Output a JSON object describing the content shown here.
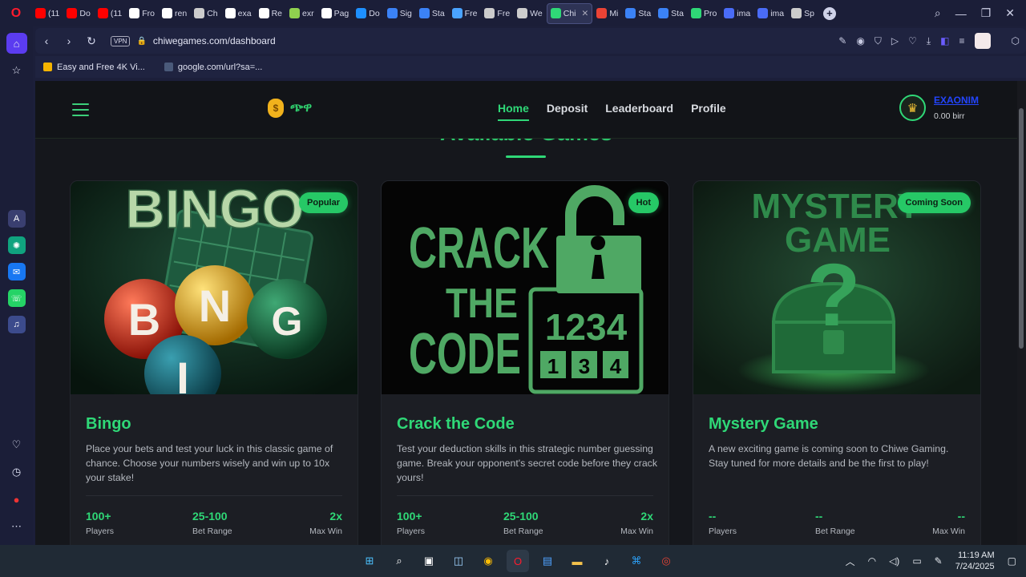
{
  "browser": {
    "tabs": [
      {
        "label": "(11",
        "color": "#ff0000"
      },
      {
        "label": "Do",
        "color": "#ff0000"
      },
      {
        "label": "(11",
        "color": "#ff0000"
      },
      {
        "label": "Fro",
        "color": "#ffffff"
      },
      {
        "label": "ren",
        "color": "#ffffff"
      },
      {
        "label": "Ch",
        "color": "#cccccc"
      },
      {
        "label": "exa",
        "color": "#ffffff"
      },
      {
        "label": "Re",
        "color": "#ffffff"
      },
      {
        "label": "exr",
        "color": "#8fd14f"
      },
      {
        "label": "Pag",
        "color": "#ffffff"
      },
      {
        "label": "Do",
        "color": "#1e90ff"
      },
      {
        "label": "Sig",
        "color": "#3b82f6"
      },
      {
        "label": "Sta",
        "color": "#3b82f6"
      },
      {
        "label": "Fre",
        "color": "#4aa3ff"
      },
      {
        "label": "Fre",
        "color": "#cccccc"
      },
      {
        "label": "We",
        "color": "#cccccc"
      },
      {
        "label": "Chi",
        "color": "#2fd877",
        "active": true
      },
      {
        "label": "Mi",
        "color": "#ea4335"
      },
      {
        "label": "Sta",
        "color": "#3b82f6"
      },
      {
        "label": "Sta",
        "color": "#3b82f6"
      },
      {
        "label": "Pro",
        "color": "#2fd877"
      },
      {
        "label": "ima",
        "color": "#4a6cf7"
      },
      {
        "label": "ima",
        "color": "#4a6cf7"
      },
      {
        "label": "Sp",
        "color": "#cccccc"
      }
    ],
    "url": "chiwegames.com/dashboard",
    "vpn_label": "VPN",
    "bookmarks": [
      {
        "label": "Easy and Free 4K Vi...",
        "color": "#f5b400"
      },
      {
        "label": "google.com/url?sa=...",
        "color": "#4a5a7a"
      }
    ]
  },
  "site": {
    "brand": "ጭዋ",
    "menu": [
      {
        "label": "Home",
        "active": true
      },
      {
        "label": "Deposit"
      },
      {
        "label": "Leaderboard"
      },
      {
        "label": "Profile"
      }
    ],
    "user": {
      "name": "EXAONIM",
      "balance": "0.00 birr"
    },
    "heading": "Available Games",
    "games": [
      {
        "badge": "Popular",
        "title": "Bingo",
        "description": "Place your bets and test your luck in this classic game of chance. Choose your numbers wisely and win up to 10x your stake!",
        "stats": [
          {
            "value": "100+",
            "label": "Players"
          },
          {
            "value": "25-100",
            "label": "Bet Range"
          },
          {
            "value": "2x",
            "label": "Max Win"
          }
        ],
        "art_text": [
          "BINGO",
          "B",
          "N",
          "G",
          "I"
        ]
      },
      {
        "badge": "Hot",
        "title": "Crack the Code",
        "description": "Test your deduction skills in this strategic number guessing game. Break your opponent's secret code before they crack yours!",
        "stats": [
          {
            "value": "100+",
            "label": "Players"
          },
          {
            "value": "25-100",
            "label": "Bet Range"
          },
          {
            "value": "2x",
            "label": "Max Win"
          }
        ],
        "art_text": [
          "CRACK",
          "THE",
          "CODE",
          "1234",
          "1",
          "3",
          "4"
        ]
      },
      {
        "badge": "Coming Soon",
        "title": "Mystery Game",
        "description": "A new exciting game is coming soon to Chiwe Gaming. Stay tuned for more details and be the first to play!",
        "stats": [
          {
            "value": "--",
            "label": "Players"
          },
          {
            "value": "--",
            "label": "Bet Range"
          },
          {
            "value": "--",
            "label": "Max Win"
          }
        ],
        "art_text": [
          "MYSTERY",
          "GAME",
          "?"
        ]
      }
    ]
  },
  "taskbar": {
    "time": "11:19 AM",
    "date": "7/24/2025"
  }
}
